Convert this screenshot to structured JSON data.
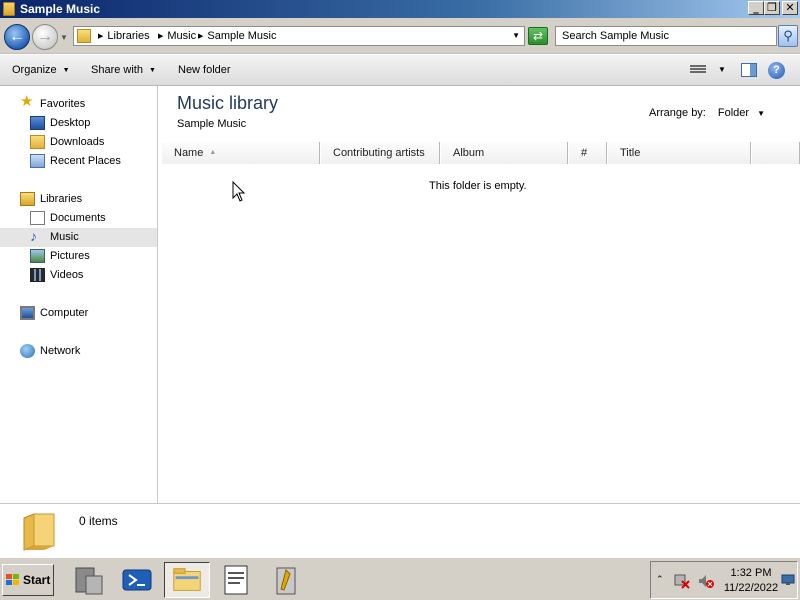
{
  "window": {
    "title": "Sample Music"
  },
  "address": {
    "breadcrumbs": [
      "Libraries",
      "Music",
      "Sample Music"
    ],
    "search_placeholder": "Search Sample Music"
  },
  "commands": {
    "organize": "Organize",
    "share_with": "Share with",
    "new_folder": "New folder"
  },
  "nav": {
    "favorites": "Favorites",
    "desktop": "Desktop",
    "downloads": "Downloads",
    "recent_places": "Recent Places",
    "libraries": "Libraries",
    "documents": "Documents",
    "music": "Music",
    "pictures": "Pictures",
    "videos": "Videos",
    "computer": "Computer",
    "network": "Network",
    "selected": "Music"
  },
  "main": {
    "title": "Music library",
    "subtitle": "Sample Music",
    "arrange_label": "Arrange by:",
    "arrange_value": "Folder",
    "columns": [
      "Name",
      "Contributing artists",
      "Album",
      "#",
      "Title"
    ],
    "empty_message": "This folder is empty."
  },
  "details": {
    "item_count": "0 items"
  },
  "taskbar": {
    "start": "Start",
    "clock_time": "1:32 PM",
    "clock_date": "11/22/2022"
  },
  "icons": {
    "back": "back-arrow-icon",
    "forward": "forward-arrow-icon",
    "refresh": "refresh-icon",
    "search": "search-icon",
    "help": "help-icon"
  }
}
